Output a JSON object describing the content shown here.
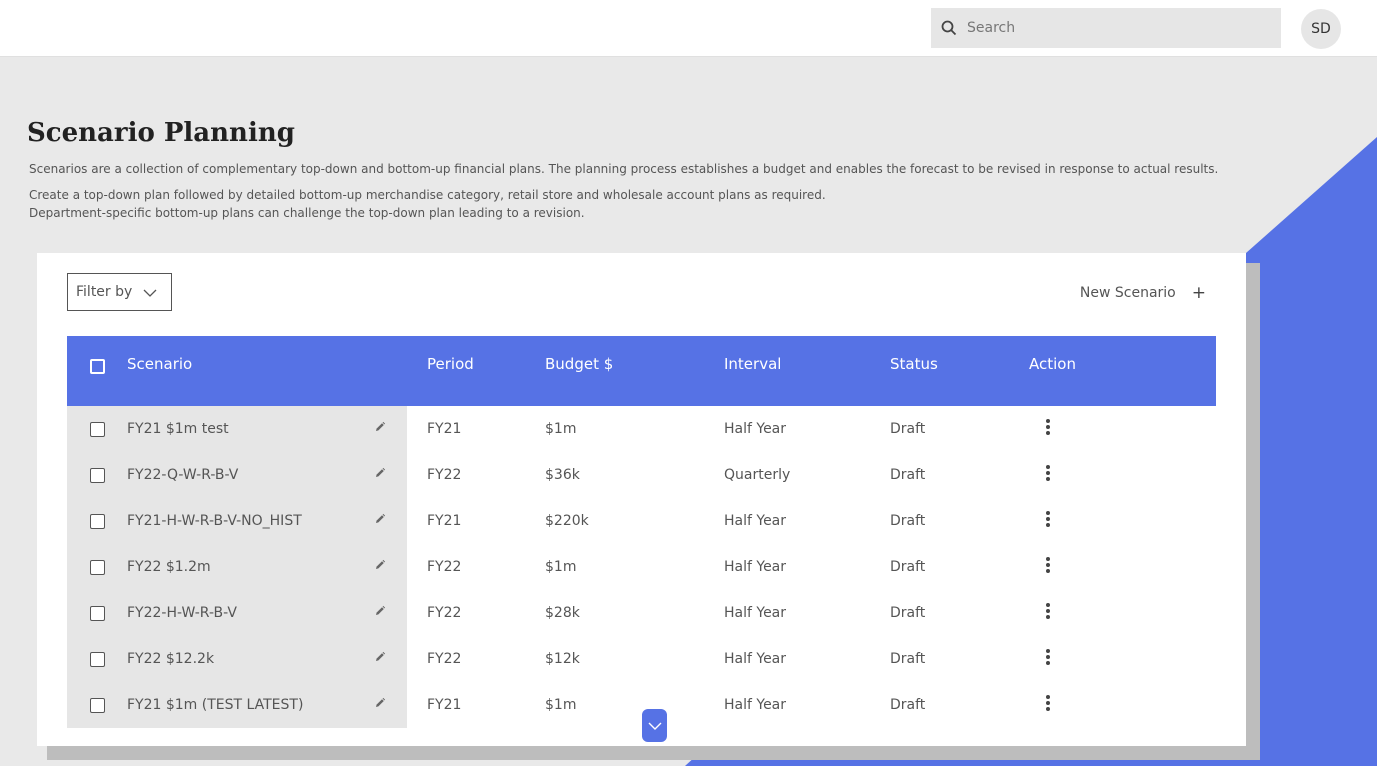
{
  "header": {
    "search_placeholder": "Search",
    "avatar_initials": "SD"
  },
  "page": {
    "title": "Scenario Planning",
    "desc_1": "Scenarios are a collection of complementary top-down and bottom-up financial plans. The planning process establishes a budget and enables the forecast to be revised in response to actual results.",
    "desc_2": "Create a top-down plan followed by detailed bottom-up merchandise category, retail store and wholesale account plans as required.",
    "desc_3": "Department-specific bottom-up plans can challenge the top-down plan leading to a revision."
  },
  "toolbar": {
    "filter_label": "Filter by",
    "new_scenario_label": "New Scenario",
    "new_scenario_icon": "+"
  },
  "table": {
    "columns": [
      "Scenario",
      "Period",
      "Budget $",
      "Interval",
      "Status",
      "Action"
    ],
    "rows": [
      {
        "scenario": "FY21 $1m test",
        "period": "FY21",
        "budget": "$1m",
        "interval": "Half Year",
        "status": "Draft"
      },
      {
        "scenario": "FY22-Q-W-R-B-V",
        "period": "FY22",
        "budget": "$36k",
        "interval": "Quarterly",
        "status": "Draft"
      },
      {
        "scenario": "FY21-H-W-R-B-V-NO_HIST",
        "period": "FY21",
        "budget": "$220k",
        "interval": "Half Year",
        "status": "Draft"
      },
      {
        "scenario": "FY22 $1.2m",
        "period": "FY22",
        "budget": "$1m",
        "interval": "Half Year",
        "status": "Draft"
      },
      {
        "scenario": "FY22-H-W-R-B-V",
        "period": "FY22",
        "budget": "$28k",
        "interval": "Half Year",
        "status": "Draft"
      },
      {
        "scenario": "FY22 $12.2k",
        "period": "FY22",
        "budget": "$12k",
        "interval": "Half Year",
        "status": "Draft"
      },
      {
        "scenario": "FY21 $1m (TEST LATEST)",
        "period": "FY21",
        "budget": "$1m",
        "interval": "Half Year",
        "status": "Draft"
      }
    ]
  },
  "colors": {
    "accent": "#5672e5",
    "background": "#e9e9e9",
    "row_highlight": "#e6e6e6"
  },
  "icons": {
    "search": "search-icon",
    "filter": "chevron-down-icon",
    "edit": "pencil-icon",
    "action": "kebab-menu-icon",
    "scroll": "chevron-down-icon"
  }
}
